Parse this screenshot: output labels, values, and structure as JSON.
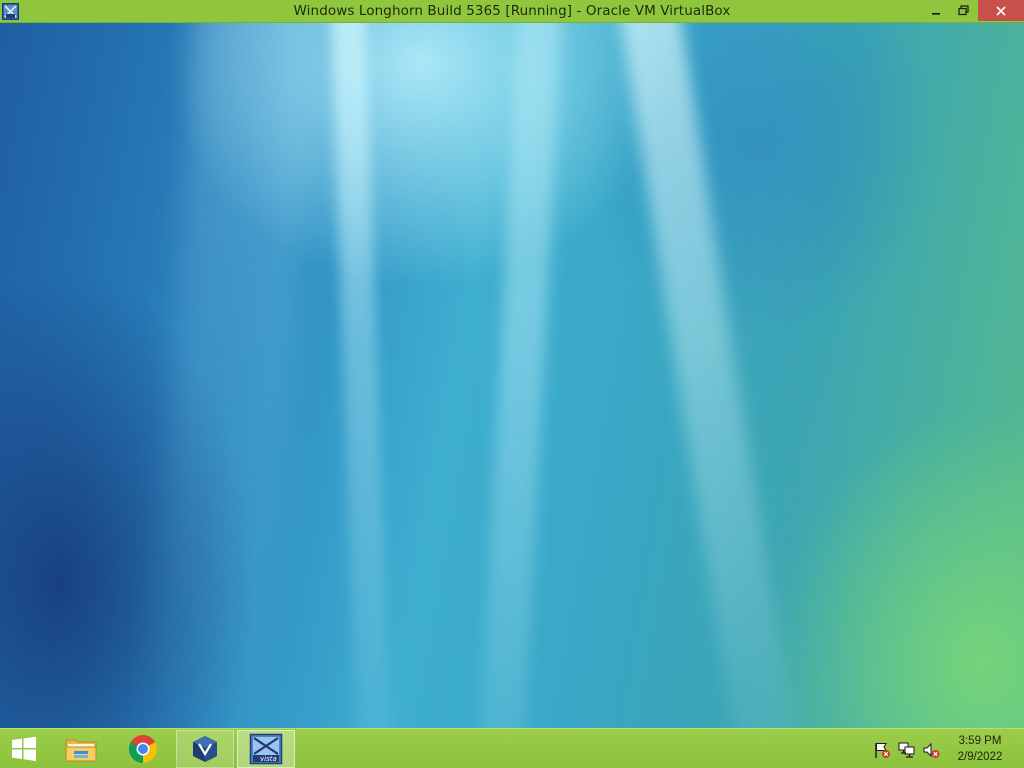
{
  "window": {
    "title": "Windows Longhorn Build 5365 [Running] - Oracle VM VirtualBox",
    "icon": "virtualbox-vm-icon",
    "controls": [
      "minimize-icon",
      "restore-icon",
      "close-icon"
    ],
    "accent_color": "#8fc63d",
    "close_color": "#c7504a"
  },
  "taskbar": {
    "color": "#8fc63d",
    "items": [
      {
        "icon": "windows-start-icon"
      },
      {
        "icon": "file-explorer-icon"
      },
      {
        "icon": "chrome-icon"
      },
      {
        "icon": "virtualbox-icon"
      },
      {
        "icon": "vista-vm-icon",
        "label": "vista"
      }
    ],
    "tray": {
      "icons": [
        "action-center-flag-icon",
        "network-icon",
        "volume-muted-icon"
      ],
      "time": "3:59 PM",
      "date": "2/9/2022"
    }
  }
}
